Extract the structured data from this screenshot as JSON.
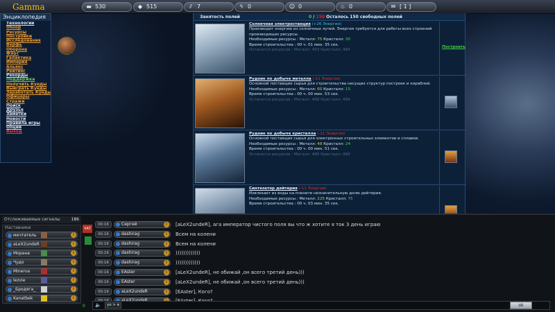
{
  "app": {
    "logo": "Gamma"
  },
  "resources": [
    {
      "icon": "metal-icon",
      "glyph": "▬",
      "value": "530"
    },
    {
      "icon": "crystal-icon",
      "glyph": "◆",
      "value": "515"
    },
    {
      "icon": "deuterium-icon",
      "glyph": "⫽",
      "value": "7"
    },
    {
      "icon": "energy-icon",
      "glyph": "ϟ",
      "value": "0"
    },
    {
      "icon": "smile-icon",
      "glyph": "☺",
      "value": "0"
    },
    {
      "icon": "fuel-icon",
      "glyph": "♨",
      "value": "0"
    },
    {
      "icon": "mail-icon",
      "glyph": "✉",
      "value": "[ 1 ]"
    }
  ],
  "sidebar": {
    "title": "Энциклопедия",
    "items": [
      {
        "label": "Технологии",
        "color": "w"
      },
      {
        "label": "Обзор",
        "color": "o"
      },
      {
        "label": "Ресурсы",
        "color": "o"
      },
      {
        "label": "Постройки",
        "color": "o"
      },
      {
        "label": "Исследования",
        "color": "o"
      },
      {
        "label": "Верфь",
        "color": "o"
      },
      {
        "label": "Оборона",
        "color": "o"
      },
      {
        "label": "Флот",
        "color": "o"
      },
      {
        "label": "Галактика",
        "color": "o"
      },
      {
        "label": "Империя",
        "color": "o"
      },
      {
        "label": "Альянс",
        "color": "o"
      },
      {
        "label": "Рейтинг",
        "color": "o"
      },
      {
        "label": "Рекорды",
        "color": "w"
      },
      {
        "label": "Поддержка",
        "color": "g"
      },
      {
        "label": "Получить Кунды",
        "color": "o"
      },
      {
        "label": "Выиграть Кунды",
        "color": "o"
      },
      {
        "label": "Заработать Кунды",
        "color": "o"
      },
      {
        "label": "Офицеры",
        "color": "o"
      },
      {
        "label": "Стражи",
        "color": "o"
      },
      {
        "label": "Поиск",
        "color": "w"
      },
      {
        "label": "Друзья",
        "color": "w"
      },
      {
        "label": "Заметки",
        "color": "w"
      },
      {
        "label": "Новости",
        "color": "w"
      },
      {
        "label": "Правила игры",
        "color": "w"
      },
      {
        "label": "Опции",
        "color": "w"
      },
      {
        "label": "Выход",
        "color": "r"
      }
    ]
  },
  "main": {
    "header_left": "Занятость полей",
    "used": "0",
    "sep": " / ",
    "max": "150",
    "header_right": " Осталось 150 свободных полей",
    "buildings": [
      {
        "name": "Солнечная электростанция",
        "energy": "(+26 Энергии)",
        "energy_neg": false,
        "desc": "Производит энергию из солнечных лучей. Энергия требуется для работы всех строений производящих ресурсы.",
        "need_label": "Необходимые ресурсы :",
        "metal_label": "Металл:",
        "metal": "75",
        "crystal_label": "Кристалл:",
        "crystal": "30",
        "deut_label": "",
        "deut": "",
        "time": "Время строительства : 00 ч. 01 мин. 35 сек.",
        "left": "Останется ресурсов : Металл: 453 Кристалл: 484",
        "action": "Построить"
      },
      {
        "name": "Рудник по добыче металла",
        "energy": "(-11 Энергии)",
        "energy_neg": true,
        "desc": "Основной поставщик сырья для строительства несущих структур построек и кораблей.",
        "need_label": "Необходимые ресурсы :",
        "metal_label": "Металл:",
        "metal": "60",
        "crystal_label": "Кристалл:",
        "crystal": "15",
        "deut_label": "",
        "deut": "",
        "time": "Время строительства : 00 ч. 00 мин. 53 сек.",
        "left": "Останется ресурсов : Металл: 468 Кристалл: 499",
        "action": ""
      },
      {
        "name": "Рудник по добыче кристалла",
        "energy": "(-11 Энергии)",
        "energy_neg": true,
        "desc": "Основной поставщик сырья для электронных строительных элементов и сплавов.",
        "need_label": "Необходимые ресурсы :",
        "metal_label": "Металл:",
        "metal": "48",
        "crystal_label": "Кристалл:",
        "crystal": "24",
        "deut_label": "",
        "deut": "",
        "time": "Время строительства : 00 ч. 00 мин. 51 сек.",
        "left": "Останется ресурсов : Металл: 480 Кристалл: 490",
        "action": ""
      },
      {
        "name": "Синтезатор дейтерия",
        "energy": "(-11 Энергии)",
        "energy_neg": true,
        "desc": "Извлекает из воды на планете незначительную долю дейтерия.",
        "need_label": "Необходимые ресурсы :",
        "metal_label": "Металл:",
        "metal": "225",
        "crystal_label": "Кристалл:",
        "crystal": "75",
        "deut_label": "",
        "deut": "",
        "time": "Время строительства : 00 ч. 03 мин. 35 сек.",
        "left": "",
        "action": ""
      }
    ]
  },
  "signals": {
    "label": "Отслеживаемые сигналы",
    "count": "186"
  },
  "mentors": {
    "title": "Наставники",
    "list": [
      "мечтатель",
      "aLeX2undeR",
      "Морана",
      "Чудо",
      "Minerva",
      "lezvie",
      "_Бродяга_",
      "Kanatbek"
    ]
  },
  "chat": [
    {
      "time": "00:16",
      "user": "Cергей",
      "text": "[aLeX2undeR], ага император чистого поля вы что ж хотите я ток 3 день играю"
    },
    {
      "time": "00:16",
      "user": "dashirag",
      "text": "Всем на колени"
    },
    {
      "time": "00:16",
      "user": "dashirag",
      "text": "Всем на колени"
    },
    {
      "time": "00:16",
      "user": "dashirag",
      "text": ")))))))))))))"
    },
    {
      "time": "00:16",
      "user": "dashirag",
      "text": ")))))))))))))"
    },
    {
      "time": "00:16",
      "user": "EAster",
      "text": "[aLeX2undeR], не обижай ,он всего третий день)))"
    },
    {
      "time": "00:16",
      "user": "EAster",
      "text": "[aLeX2undeR], не обижай ,он всего третий день)))"
    },
    {
      "time": "00:16",
      "user": "aLeX2undeR",
      "text": "[EAster], Кого?"
    },
    {
      "time": "00:16",
      "user": "aLeX2undeR",
      "text": "[EAster], Кого?"
    }
  ],
  "input": {
    "mode": "yo > e",
    "value": "",
    "ok_label": "ok",
    "counter": "0"
  },
  "flag_label": "ЧАТ"
}
